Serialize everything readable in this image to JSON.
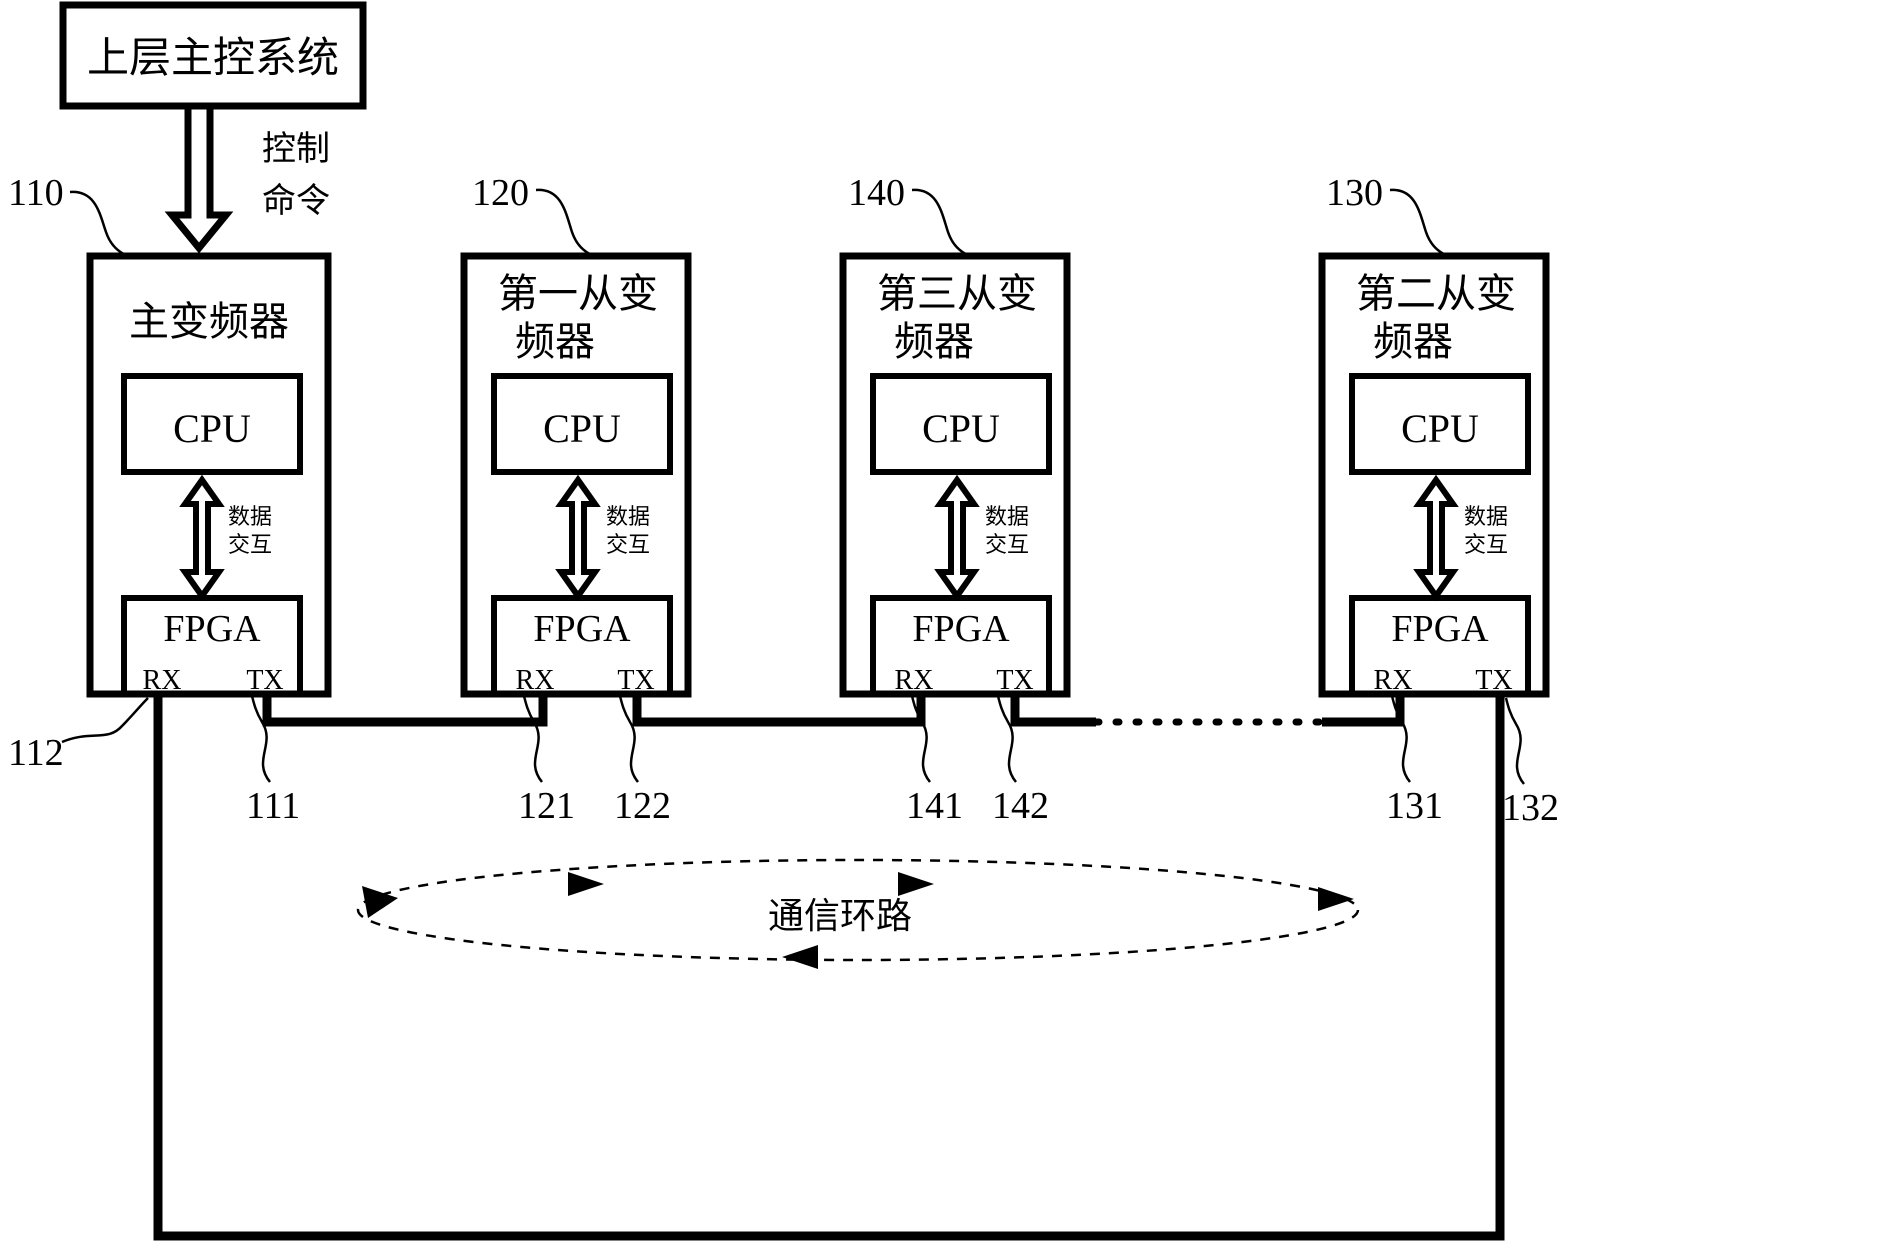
{
  "figure": {
    "title_block": {
      "label": "上层主控系统"
    },
    "command_arrow_label_line1": "控制",
    "command_arrow_label_line2": "命令",
    "loop_label": "通信环路",
    "data_exchange_line1": "数据",
    "data_exchange_line2": "交互",
    "cpu_label": "CPU",
    "fpga_label": "FPGA",
    "rx_label": "RX",
    "tx_label": "TX"
  },
  "devices": [
    {
      "ref": "110",
      "title_line1": "主变频器",
      "title_line2": "",
      "cpu": "CPU",
      "fpga": "FPGA",
      "rx": "RX",
      "tx": "TX",
      "rx_ref": "112",
      "tx_ref": "111",
      "data_exchange_line1": "数据",
      "data_exchange_line2": "交互"
    },
    {
      "ref": "120",
      "title_line1": "第一从变",
      "title_line2": "频器",
      "cpu": "CPU",
      "fpga": "FPGA",
      "rx": "RX",
      "tx": "TX",
      "rx_ref": "121",
      "tx_ref": "122",
      "data_exchange_line1": "数据",
      "data_exchange_line2": "交互"
    },
    {
      "ref": "140",
      "title_line1": "第三从变",
      "title_line2": "频器",
      "cpu": "CPU",
      "fpga": "FPGA",
      "rx": "RX",
      "tx": "TX",
      "rx_ref": "141",
      "tx_ref": "142",
      "data_exchange_line1": "数据",
      "data_exchange_line2": "交互"
    },
    {
      "ref": "130",
      "title_line1": "第二从变",
      "title_line2": "频器",
      "cpu": "CPU",
      "fpga": "FPGA",
      "rx": "RX",
      "tx": "TX",
      "rx_ref": "131",
      "tx_ref": "132",
      "data_exchange_line1": "数据",
      "data_exchange_line2": "交互"
    }
  ],
  "colors": {
    "stroke": "#000000",
    "background": "#ffffff"
  }
}
